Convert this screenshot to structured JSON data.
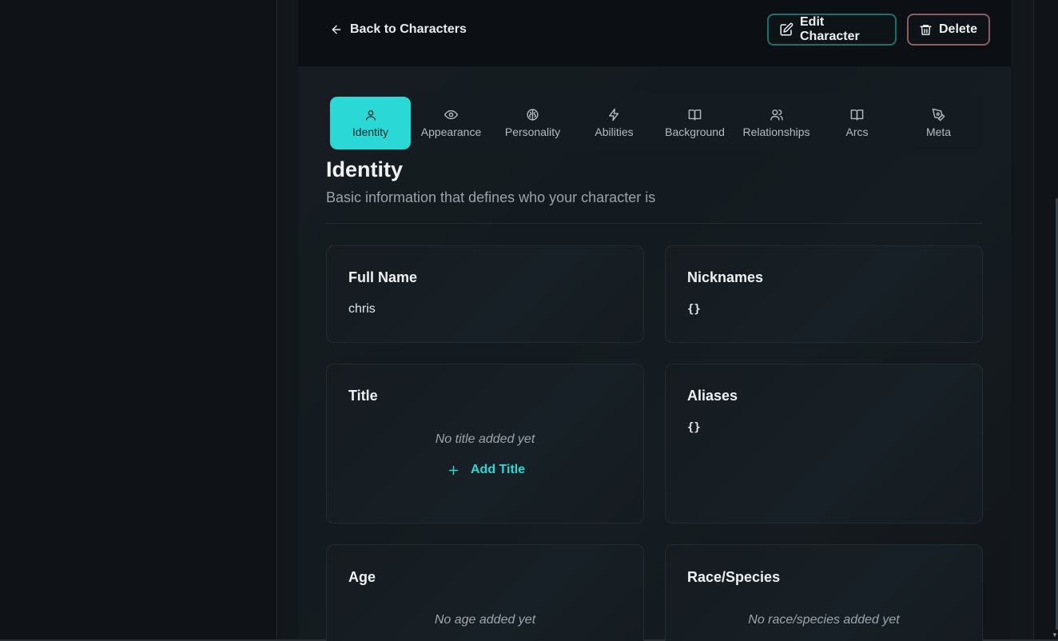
{
  "header": {
    "back_label": "Back to Characters",
    "edit_label": "Edit Character",
    "delete_label": "Delete"
  },
  "tabs": [
    {
      "label": "Identity",
      "icon": "user-icon",
      "active": true
    },
    {
      "label": "Appearance",
      "icon": "eye-icon",
      "active": false
    },
    {
      "label": "Personality",
      "icon": "brain-icon",
      "active": false
    },
    {
      "label": "Abilities",
      "icon": "lightning-icon",
      "active": false
    },
    {
      "label": "Background",
      "icon": "book-open-icon",
      "active": false
    },
    {
      "label": "Relationships",
      "icon": "users-icon",
      "active": false
    },
    {
      "label": "Arcs",
      "icon": "book-open-icon",
      "active": false
    },
    {
      "label": "Meta",
      "icon": "pen-tool-icon",
      "active": false
    }
  ],
  "section": {
    "title": "Identity",
    "subtitle": "Basic information that defines who your character is"
  },
  "fields": {
    "full_name": {
      "label": "Full Name",
      "value": "chris"
    },
    "nicknames": {
      "label": "Nicknames",
      "value": "{}"
    },
    "title": {
      "label": "Title",
      "empty": "No title added yet",
      "add_label": "Add Title"
    },
    "aliases": {
      "label": "Aliases",
      "value": "{}"
    },
    "age": {
      "label": "Age",
      "empty": "No age added yet"
    },
    "race_species": {
      "label": "Race/Species",
      "empty": "No race/species added yet"
    }
  },
  "colors": {
    "accent": "#2ad8d5",
    "background": "#101419",
    "edit_border": "#1f6e6a",
    "delete_border": "#8a5d63"
  }
}
